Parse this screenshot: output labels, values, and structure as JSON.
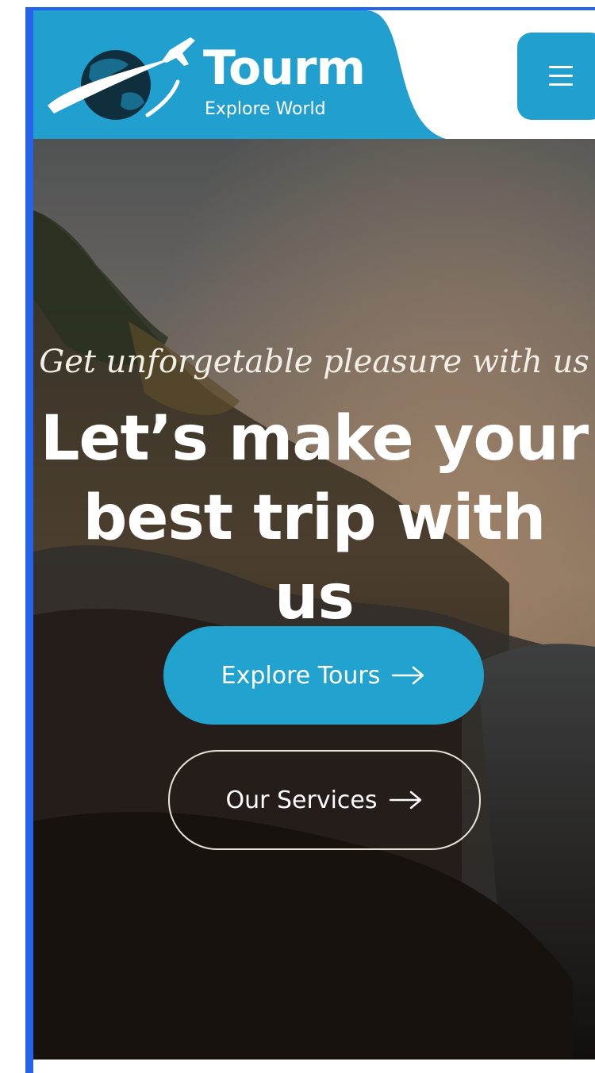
{
  "header": {
    "brand_name": "Tourm",
    "brand_tagline": "Explore World",
    "logo_icon": "globe-plane-icon",
    "menu_icon": "hamburger-icon"
  },
  "hero": {
    "subtitle": "Get unforgetable pleasure with us",
    "title_line1": "Let’s make your",
    "title_line2": "best trip with us",
    "primary_button": "Explore Tours",
    "secondary_button": "Our Services",
    "button_icon": "arrow-right-icon"
  },
  "colors": {
    "accent": "#21a0cf",
    "selection_border": "#2563ea"
  }
}
